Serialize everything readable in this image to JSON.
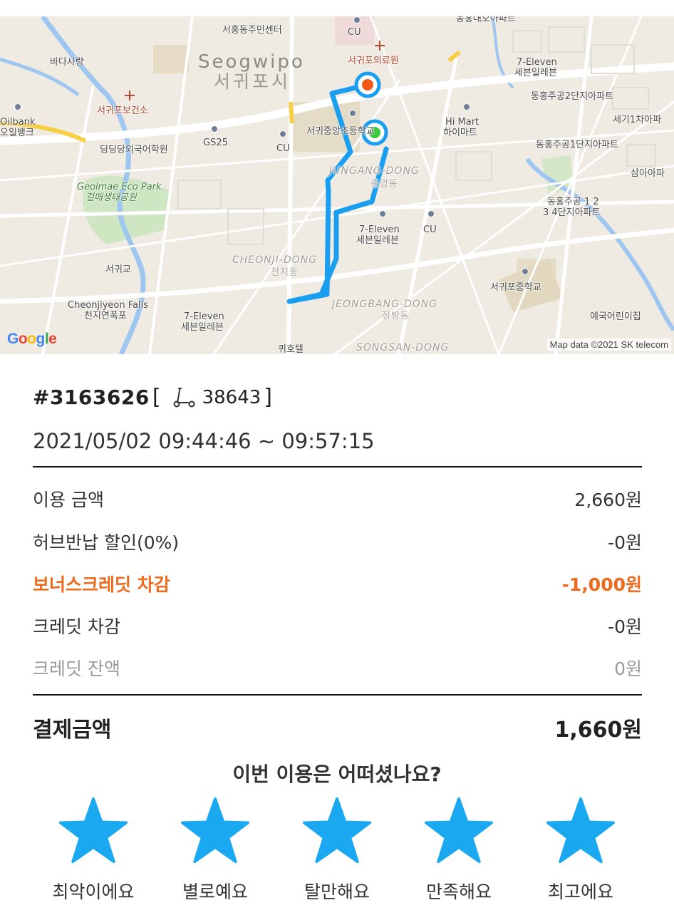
{
  "map": {
    "labels": {
      "seodong": "서홍동주민센터",
      "cu_top": "CU",
      "dongdae": "동홍대오아파트",
      "badasarang": "바다사랑",
      "seogwipo_en": "Seogwipo",
      "seogwipo_ko": "서귀포시",
      "clinic": "서귀포의료원",
      "eleven_top_en": "7-Eleven",
      "eleven_top_ko": "세븐일레븐",
      "health_center": "서귀포보건소",
      "dongheung2": "동홍주공2단지아파트",
      "segi1": "세기1차아파",
      "oilbank_en": "Oilbank",
      "oilbank_ko": "오일뱅크",
      "school_center": "서귀중앙초등학교",
      "himart_en": "Hi Mart",
      "himart_ko": "하이마트",
      "dingdang": "딩딩당외국어학원",
      "gs25": "GS25",
      "cu_mid": "CU",
      "dongheung1": "동홍주공1단지아파트",
      "samah": "삼아아파",
      "eco_park_en": "Geolmae Eco Park",
      "eco_park_ko": "걸매생태공원",
      "jungang_en": "JUNGANG-DONG",
      "jungang_ko": "중앙동",
      "dongheung12_a": "동홍주공 1 2",
      "dongheung12_b": "3 4단지아파트",
      "eleven_mid_en": "7-Eleven",
      "eleven_mid_ko": "세븐일레븐",
      "cu_low": "CU",
      "seogwi_gyo": "서귀교",
      "cheonji_en": "CHEONJI-DONG",
      "cheonji_ko": "천지동",
      "middle_school": "서귀포중학교",
      "falls_en": "Cheonjiyeon Falls",
      "falls_ko": "천지연폭포",
      "eleven_low_en": "7-Eleven",
      "eleven_low_ko": "세븐일레븐",
      "jeongbang_en": "JEONGBANG-DONG",
      "jeongbang_ko": "정방동",
      "kindergarten": "예국어린이집",
      "hotel": "퀴호텔",
      "songsan_en": "SONGSAN-DONG"
    },
    "google_logo": "Google",
    "attribution": "Map data ©2021 SK telecom",
    "route_color": "#1a9ef0",
    "start_color": "#3cc83c",
    "end_color": "#f05a14"
  },
  "trip": {
    "id": "#3163626",
    "bracket_open": "[",
    "scooter_icon": "kickscooter-icon",
    "scooter_number": "38643",
    "bracket_close": "]",
    "time_range": "2021/05/02 09:44:46 ~ 09:57:15"
  },
  "fees": [
    {
      "label": "이용 금액",
      "value": "2,660원"
    },
    {
      "label": "허브반납 할인(0%)",
      "value": "-0원"
    },
    {
      "label": "보너스크레딧 차감",
      "value": "-1,000원"
    },
    {
      "label": "크레딧 차감",
      "value": "-0원"
    },
    {
      "label": "크레딧 잔액",
      "value": "0원"
    }
  ],
  "total": {
    "label": "결제금액",
    "value": "1,660원"
  },
  "rating": {
    "question": "이번 이용은 어떠셨나요?",
    "star_color": "#1aa8f0",
    "options": [
      "최악이에요",
      "별로예요",
      "탈만해요",
      "만족해요",
      "최고에요"
    ]
  },
  "colors": {
    "bonus": "#ee6a1c",
    "muted": "#9a9a9a"
  }
}
